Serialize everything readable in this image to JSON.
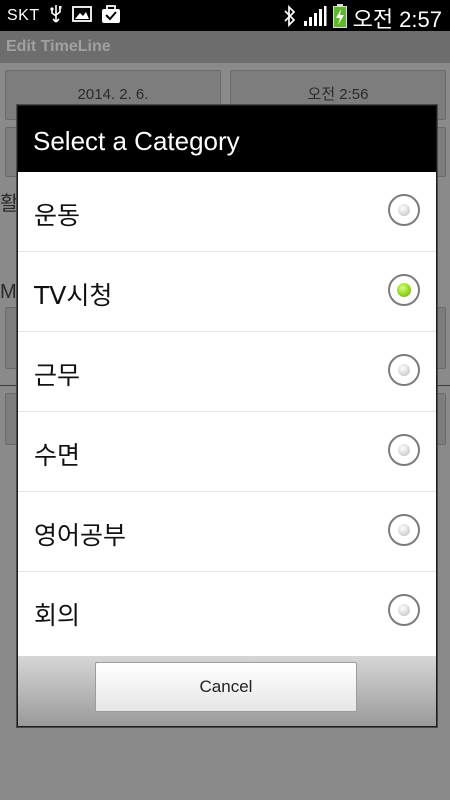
{
  "status_bar": {
    "carrier": "SKT",
    "time": "오전 2:57",
    "icons": [
      "usb-icon",
      "image-icon",
      "briefcase-check-icon",
      "bluetooth-icon",
      "signal-icon",
      "battery-charging-icon"
    ]
  },
  "app": {
    "title": "Edit TimeLine",
    "date_button": "2014. 2. 6.",
    "time_button": "오전 2:56",
    "partial_label_1": "활",
    "partial_label_2": "M"
  },
  "dialog": {
    "title": "Select a Category",
    "options": [
      {
        "label": "운동",
        "checked": false
      },
      {
        "label": "TV시청",
        "checked": true
      },
      {
        "label": "근무",
        "checked": false
      },
      {
        "label": "수면",
        "checked": false
      },
      {
        "label": "영어공부",
        "checked": false
      },
      {
        "label": "회의",
        "checked": false
      }
    ],
    "cancel_label": "Cancel"
  },
  "colors": {
    "radio_checked": "#8ed21a",
    "dialog_header": "#000000"
  }
}
